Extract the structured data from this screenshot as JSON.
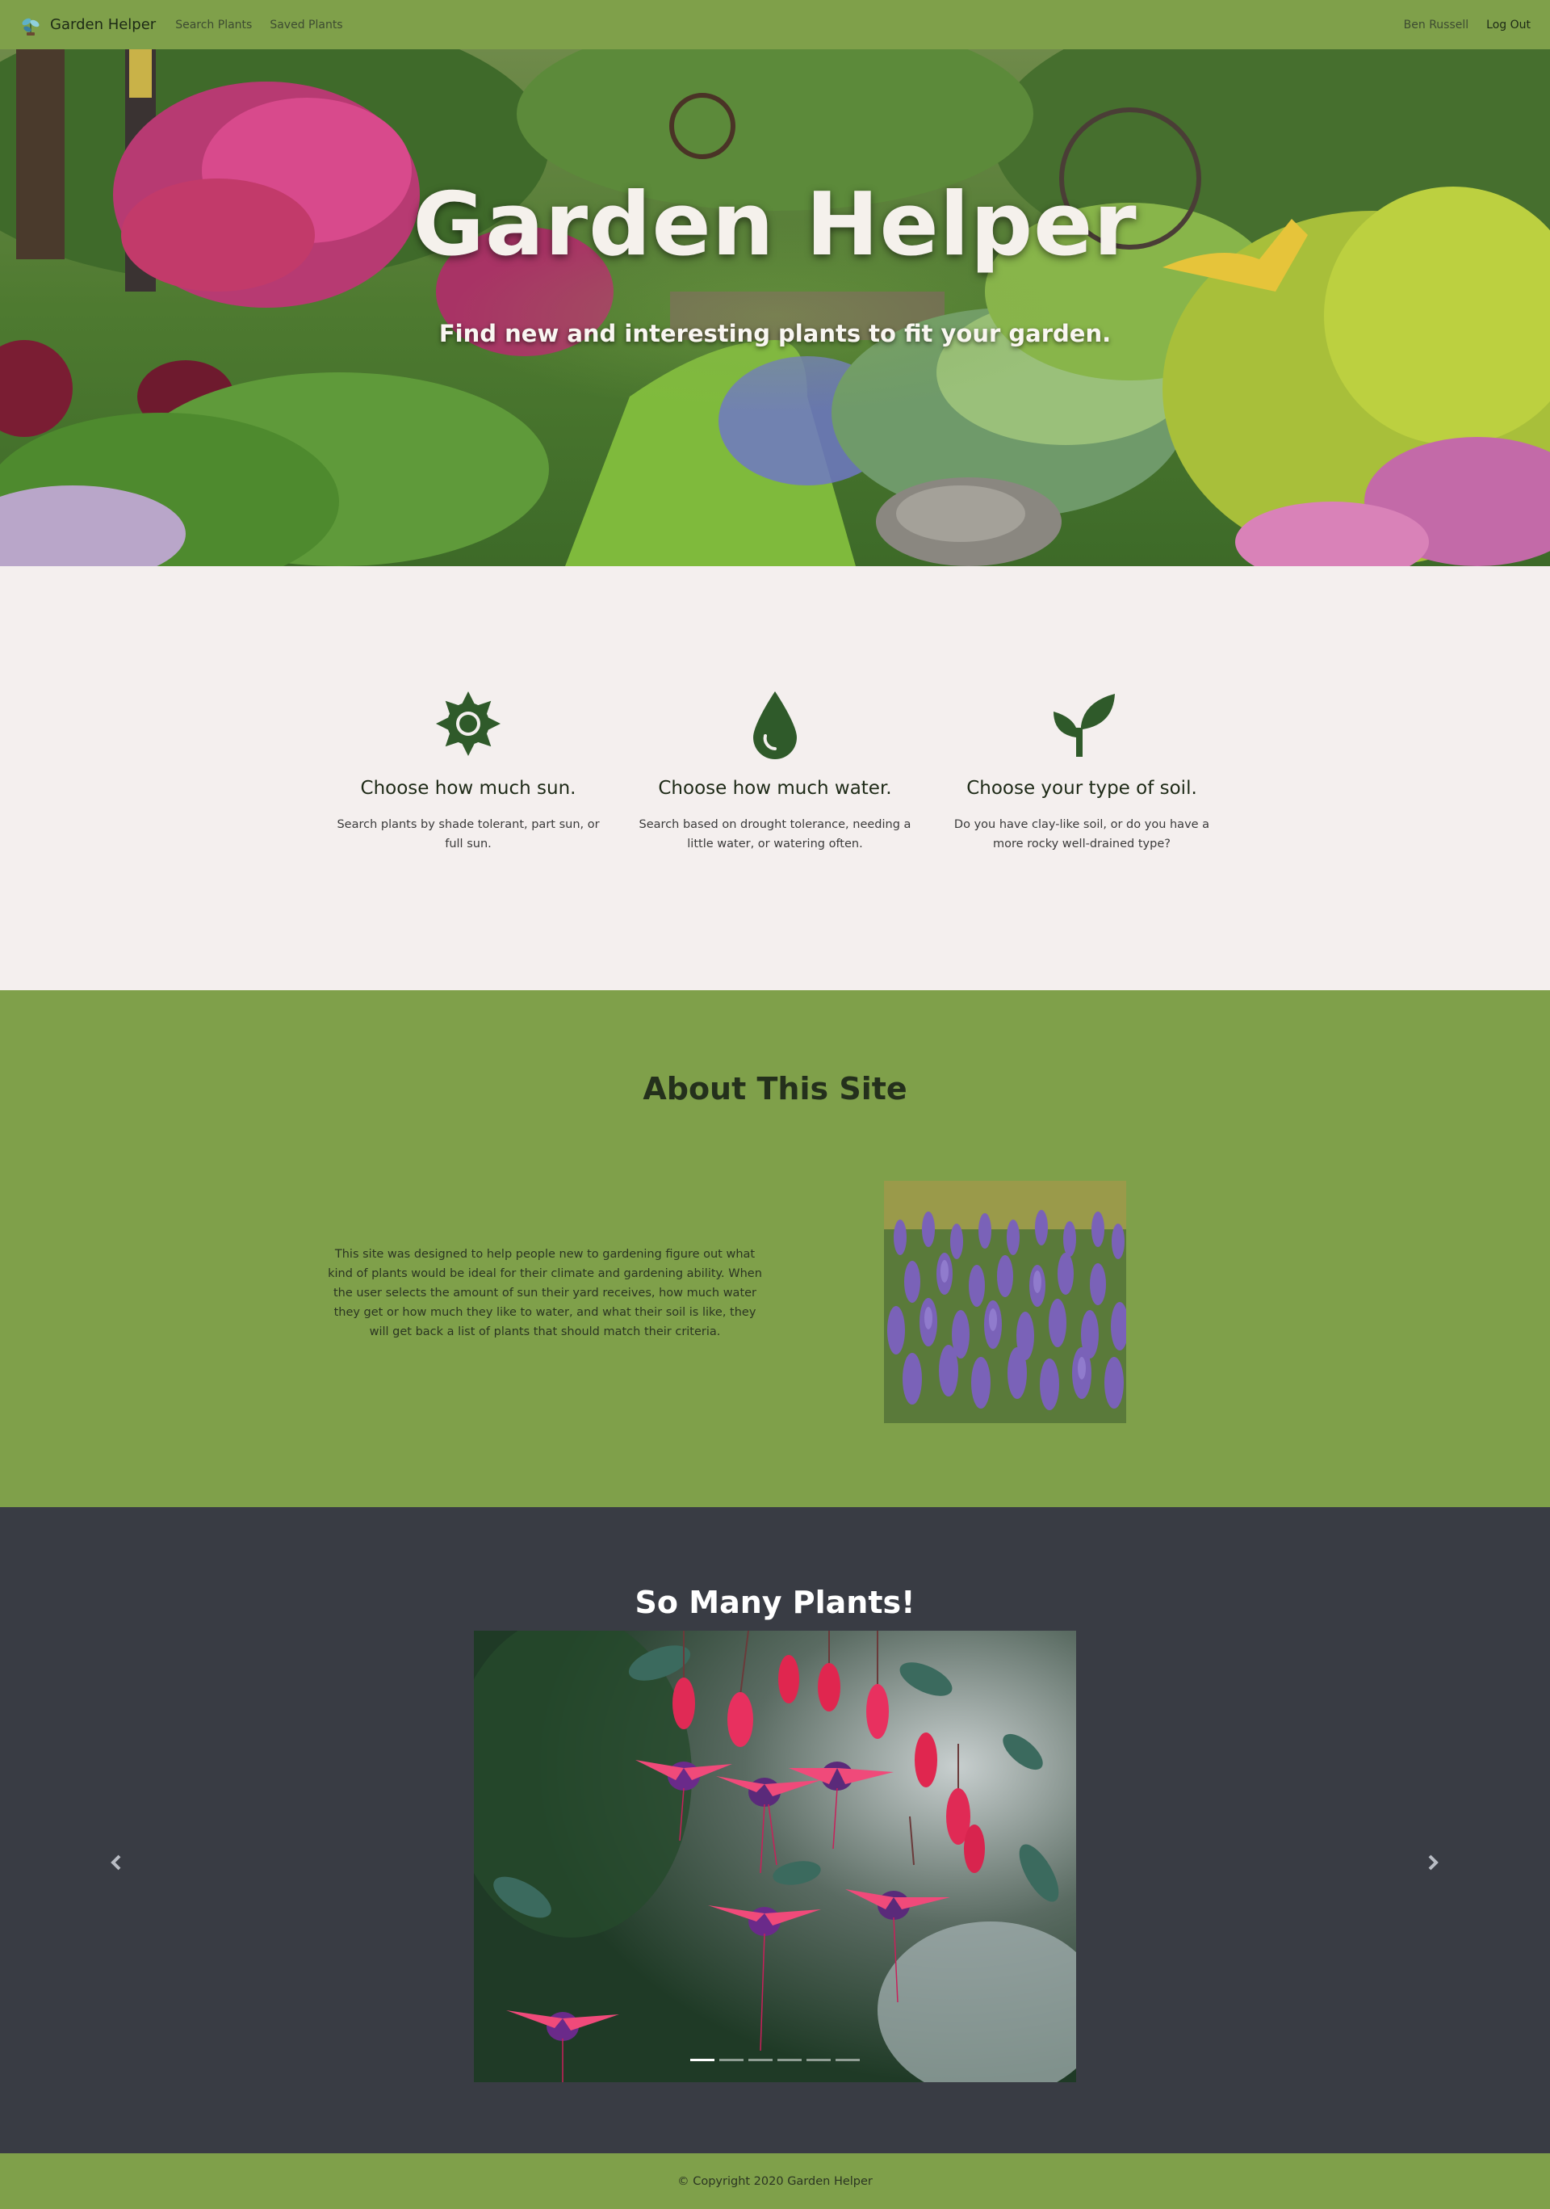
{
  "nav": {
    "brand": "Garden Helper",
    "links": [
      "Search Plants",
      "Saved Plants"
    ],
    "user": "Ben Russell",
    "logout": "Log Out"
  },
  "hero": {
    "title": "Garden Helper",
    "subtitle": "Find new and interesting plants to fit your garden."
  },
  "features": [
    {
      "icon": "sun-icon",
      "title": "Choose how much sun.",
      "text": "Search plants by shade tolerant, part sun, or full sun."
    },
    {
      "icon": "water-drop-icon",
      "title": "Choose how much water.",
      "text": "Search based on drought tolerance, needing a little water, or watering often."
    },
    {
      "icon": "sprout-icon",
      "title": "Choose your type of soil.",
      "text": "Do you have clay-like soil, or do you have a more rocky well-drained type?"
    }
  ],
  "about": {
    "title": "About This Site",
    "text": "This site was designed to help people new to gardening figure out what kind of plants would be ideal for their climate and gardening ability. When the user selects the amount of sun their yard receives, how much water they get or how much they like to water, and what their soil is like, they will get back a list of plants that should match their criteria."
  },
  "carousel": {
    "title": "So Many Plants!",
    "slide_count": 6,
    "active_index": 0
  },
  "footer": {
    "text": "© Copyright 2020 Garden Helper"
  },
  "colors": {
    "accent_green": "#7fa04a",
    "dark_slate": "#393c44",
    "light_bg": "#f4efee",
    "icon_green": "#2f5a2a"
  }
}
